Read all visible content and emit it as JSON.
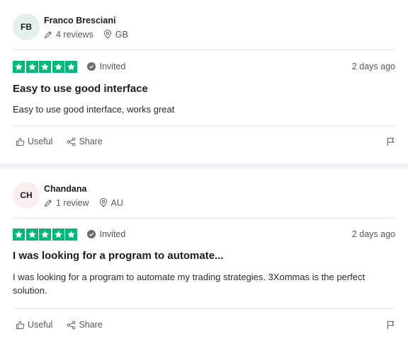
{
  "reviews": [
    {
      "avatar_initials": "FB",
      "avatar_color": "#e4f0ec",
      "name": "Franco Bresciani",
      "review_count": "4 reviews",
      "country": "GB",
      "rating": 5,
      "invited_label": "Invited",
      "date": "2 days ago",
      "title": "Easy to use good interface",
      "text": "Easy to use good interface, works great",
      "useful_label": "Useful",
      "share_label": "Share"
    },
    {
      "avatar_initials": "CH",
      "avatar_color": "#fbeef1",
      "name": "Chandana",
      "review_count": "1 review",
      "country": "AU",
      "rating": 5,
      "invited_label": "Invited",
      "date": "2 days ago",
      "title": "I was looking for a program to automate...",
      "text": "I was looking for a program to automate my trading strategies. 3Xommas is the perfect solution.",
      "useful_label": "Useful",
      "share_label": "Share"
    }
  ],
  "colors": {
    "star_green": "#00b67a",
    "page_bg": "#f1f1f6",
    "card_bg": "#ffffff"
  },
  "icons": [
    "pencil-icon",
    "location-pin-icon",
    "star-icon",
    "check-circle-icon",
    "thumbs-up-icon",
    "share-icon",
    "flag-icon"
  ]
}
